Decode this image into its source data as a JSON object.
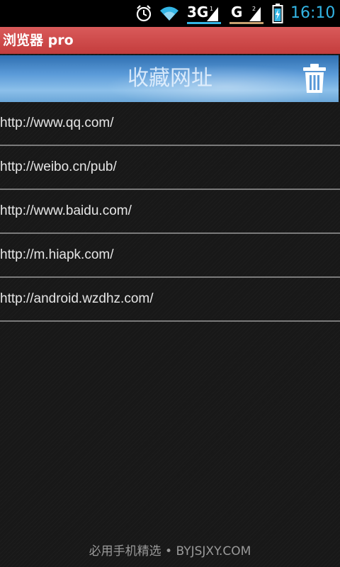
{
  "status_bar": {
    "network_3g": "3G",
    "network_g": "G",
    "time": "16:10",
    "icons": [
      "alarm-clock-icon",
      "wifi-icon",
      "signal-icon",
      "signal-icon",
      "battery-icon"
    ]
  },
  "app": {
    "title": "浏览器 pro"
  },
  "banner": {
    "title": "收藏网址",
    "delete_icon": "trash-icon"
  },
  "bookmarks": [
    {
      "url": "http://www.qq.com/"
    },
    {
      "url": "http://weibo.cn/pub/"
    },
    {
      "url": "http://www.baidu.com/"
    },
    {
      "url": "http://m.hiapk.com/"
    },
    {
      "url": "http://android.wzdhz.com/"
    }
  ],
  "footer": {
    "watermark": "必用手机精选 • BYJSJXY.COM"
  },
  "colors": {
    "status_accent": "#33b5e5",
    "title_bar": "#c43d3d",
    "banner": "#5a9ad8",
    "background": "#181818"
  }
}
